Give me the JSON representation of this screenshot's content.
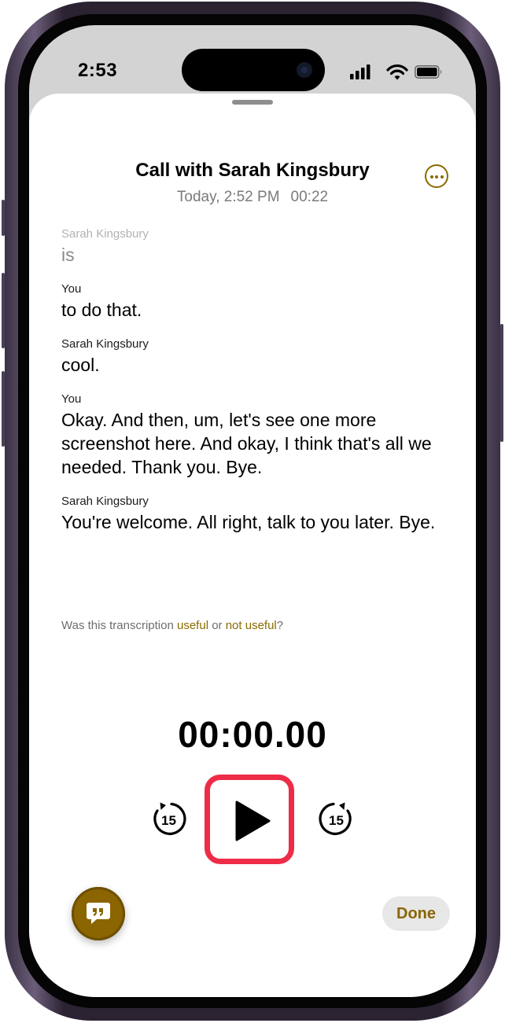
{
  "status_bar": {
    "time": "2:53"
  },
  "header": {
    "title": "Call with Sarah Kingsbury",
    "date": "Today, 2:52 PM",
    "duration": "00:22",
    "more_icon": "ellipsis-circle-icon"
  },
  "transcript": [
    {
      "speaker": "Sarah Kingsbury",
      "text": "is"
    },
    {
      "speaker": "You",
      "text": "to do that."
    },
    {
      "speaker": "Sarah Kingsbury",
      "text": "cool."
    },
    {
      "speaker": "You",
      "text": "Okay. And then, um, let's see one more screenshot here. And okay, I think that's all we needed. Thank you. Bye."
    },
    {
      "speaker": "Sarah Kingsbury",
      "text": "You're welcome. All right, talk to you later. Bye."
    }
  ],
  "feedback": {
    "prefix": "Was this transcription ",
    "useful": "useful",
    "middle": " or ",
    "not_useful": "not useful",
    "suffix": "?"
  },
  "player": {
    "elapsed": "00:00.00",
    "skip_back_label": "15",
    "skip_forward_label": "15"
  },
  "footer": {
    "done_label": "Done",
    "transcript_icon": "quote-bubble-icon"
  },
  "colors": {
    "accent": "#8a6500",
    "highlight": "#ee2c48"
  }
}
